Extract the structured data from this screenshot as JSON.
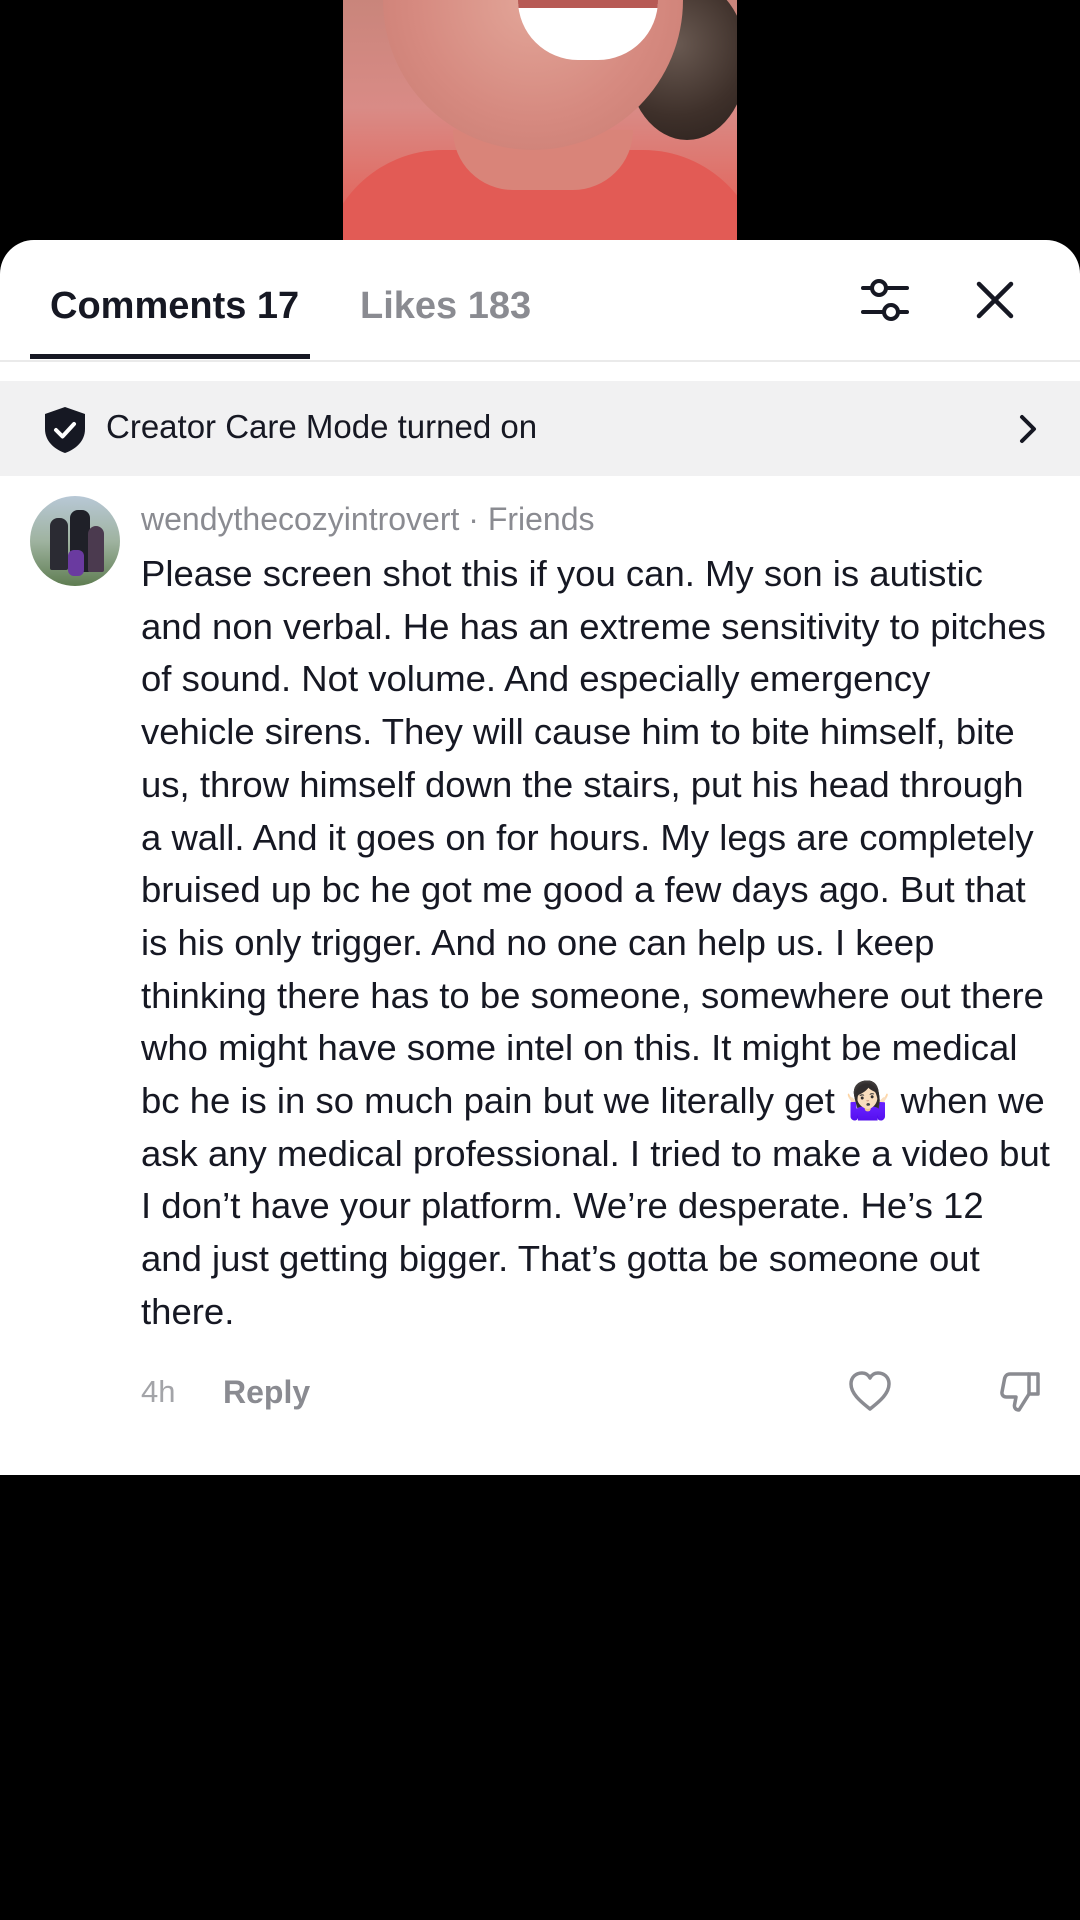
{
  "tabs": {
    "comments_label": "Comments 17",
    "likes_label": "Likes 183"
  },
  "icons": {
    "filter": "sliders-icon",
    "close": "close-icon",
    "shield": "shield-check-icon",
    "chevron": "chevron-right-icon",
    "like": "heart-outline-icon",
    "dislike": "thumbs-down-icon"
  },
  "banner": {
    "text": "Creator Care Mode turned on"
  },
  "comment": {
    "username": "wendythecozyintrovert",
    "relationship": "Friends",
    "header": "wendythecozyintrovert · Friends",
    "text": "Please screen shot this if you can. My son is autistic and non verbal. He has an extreme sensitivity to pitches of sound. Not volume. And especially emergency vehicle sirens. They will cause him to bite himself, bite us, throw himself down the stairs, put his head through a wall. And it goes on for hours. My legs are completely bruised up bc he got me good a few days ago. But that is his only trigger. And no one can help us. I keep thinking there has to be someone, somewhere out there who might have some intel on this. It might be medical bc he is in so much pain but we literally get 🤷🏻‍♀️ when we ask any medical professional. I tried to make a video but I don’t have your platform. We’re desperate. He’s 12 and just getting bigger. That’s gotta be someone out there.",
    "time": "4h",
    "reply_label": "Reply"
  },
  "colors": {
    "text_primary": "#161823",
    "text_secondary": "#8a8b91",
    "banner_bg": "#f1f1f2",
    "backdrop": "#000000"
  }
}
